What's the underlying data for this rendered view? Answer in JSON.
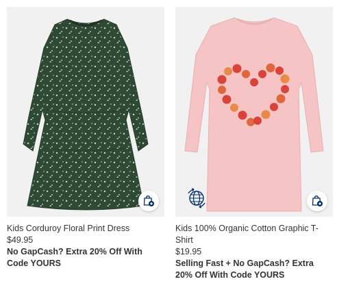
{
  "products": [
    {
      "title": "Kids Corduroy Floral Print Dress",
      "price": "$49.95",
      "promo": "No GapCash? Extra 20% Off With Code YOURS",
      "bag_icon": "shopping-bag-plus-icon",
      "image_name": "green-floral-dress"
    },
    {
      "title": "Kids 100% Organic Cotton Graphic T-Shirt",
      "price": "$19.95",
      "promo": "Selling Fast + No GapCash? Extra 20% Off With Code YOURS",
      "bag_icon": "shopping-bag-plus-icon",
      "eco_icon": "globe-recycle-icon",
      "image_name": "pink-apple-heart-tee"
    }
  ],
  "colors": {
    "image_bg": "#f1f1f1",
    "dress_green": "#2e4a34",
    "tee_pink": "#f6c4c4",
    "apple_red": "#d9433a",
    "navy": "#002e6b"
  }
}
